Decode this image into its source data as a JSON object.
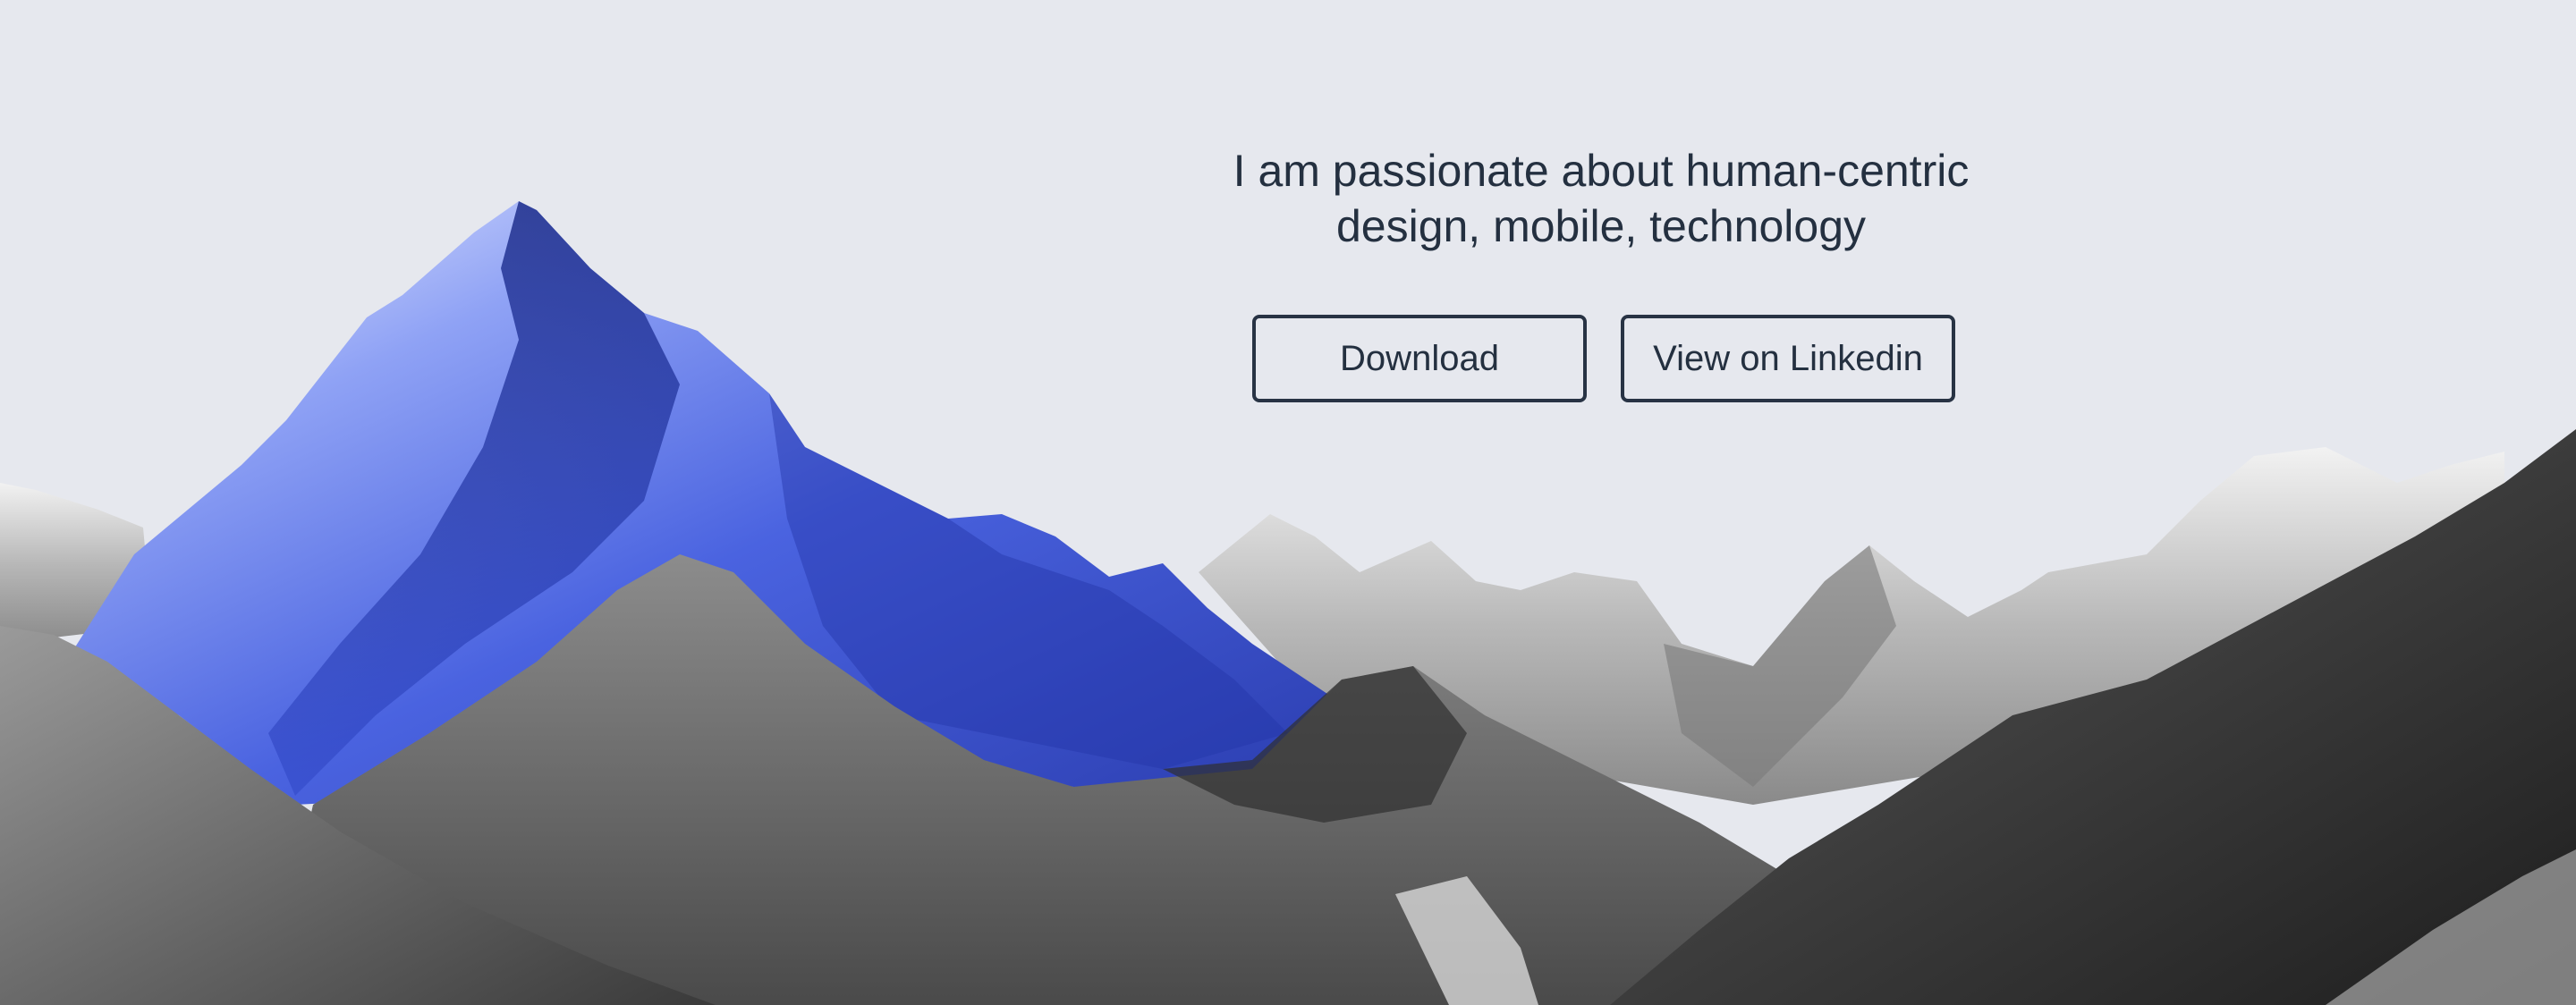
{
  "hero": {
    "tagline_line1": "I am passionate about human-centric",
    "tagline_line2": "design, mobile, technology"
  },
  "buttons": {
    "download_label": "Download",
    "linkedin_label": "View on Linkedin"
  },
  "colors": {
    "background": "#e6e8ee",
    "text": "#243040",
    "button_border": "#283344",
    "accent_blue": "#4a63e0"
  }
}
